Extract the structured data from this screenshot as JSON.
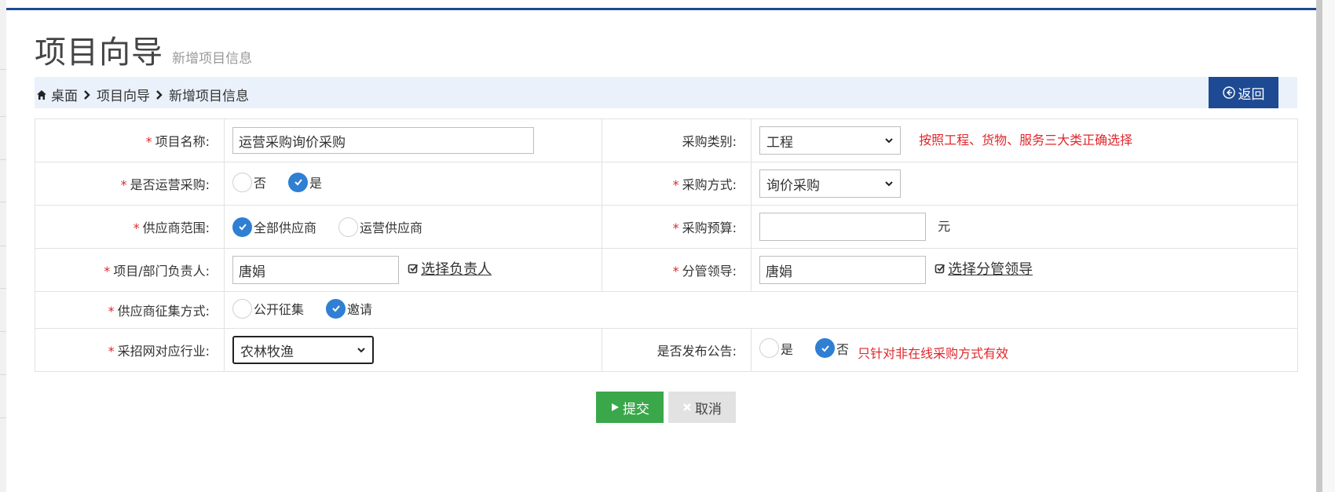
{
  "header": {
    "title": "项目向导",
    "subtitle": "新增项目信息"
  },
  "breadcrumb": {
    "items": [
      "桌面",
      "项目向导",
      "新增项目信息"
    ],
    "back_label": "返回"
  },
  "form": {
    "project_name": {
      "label": "项目名称:",
      "value": "运营采购询价采购"
    },
    "purchase_category": {
      "label": "采购类别:",
      "selected": "工程",
      "hint": "按照工程、货物、服务三大类正确选择"
    },
    "is_operational": {
      "label": "是否运营采购:",
      "options": [
        "否",
        "是"
      ],
      "selected": "是"
    },
    "purchase_method": {
      "label": "采购方式:",
      "selected": "询价采购"
    },
    "supplier_scope": {
      "label": "供应商范围:",
      "options": [
        "全部供应商",
        "运营供应商"
      ],
      "selected": "全部供应商"
    },
    "budget": {
      "label": "采购预算:",
      "value": "",
      "unit": "元"
    },
    "owner": {
      "label": "项目/部门负责人:",
      "value": "唐娟",
      "pick_label": "选择负责人"
    },
    "leader": {
      "label": "分管领导:",
      "value": "唐娟",
      "pick_label": "选择分管领导"
    },
    "collect_method": {
      "label": "供应商征集方式:",
      "options": [
        "公开征集",
        "邀请"
      ],
      "selected": "邀请"
    },
    "industry": {
      "label": "采招网对应行业:",
      "selected": "农林牧渔"
    },
    "publish_notice": {
      "label": "是否发布公告:",
      "options": [
        "是",
        "否"
      ],
      "selected": "否",
      "hint": "只针对非在线采购方式有效"
    }
  },
  "actions": {
    "submit_label": "提交",
    "cancel_label": "取消"
  },
  "colors": {
    "brand": "#1e4a94",
    "radio_on": "#2f7fd3",
    "required": "#e0272b",
    "submit": "#3aa84a",
    "breadcrumb_bg": "#eaf1fb"
  }
}
